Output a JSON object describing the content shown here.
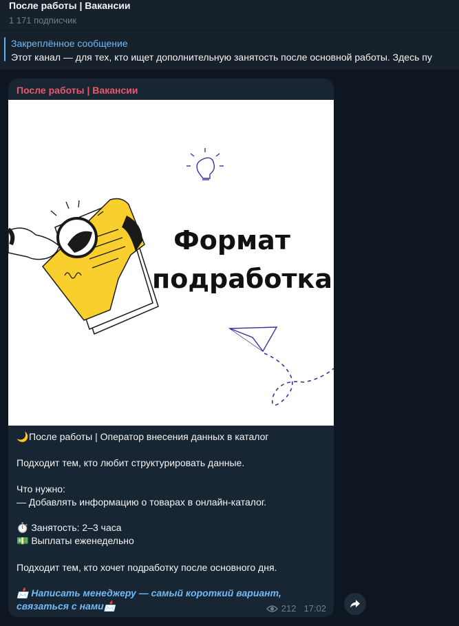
{
  "header": {
    "title": "После работы | Вакансии",
    "subscribers": "1 171 подписчик"
  },
  "pinned": {
    "title": "Закреплённое сообщение",
    "text": "Этот канал — для тех, кто ищет дополнительную занятость после основной работы.  Здесь пу"
  },
  "message": {
    "author": "После работы | Вакансии",
    "image": {
      "headline_line1": "Формат",
      "headline_line2": "подработка"
    },
    "lines": {
      "title": "После работы | Оператор внесения данных в каталог",
      "intro": "Подходит тем, кто любит структурировать данные.",
      "need_label": "Что нужно:",
      "need_item": "— Добавлять информацию о товарах в онлайн-каталог.",
      "employment": "Занятость: 2–3 часа",
      "payments": "Выплаты еженедельно",
      "closing": "Подходит тем, кто хочет подработку после основного дня.",
      "link_line1": "Написать менеджеру — самый короткий вариант,",
      "link_line2": "связаться с нами"
    },
    "views": "212",
    "time": "17:02"
  },
  "colors": {
    "background": "#0e1621",
    "panel": "#17212b",
    "bubble": "#182533",
    "author": "#e9596a",
    "link": "#71baf5",
    "muted": "#6d7f8f"
  },
  "icons": [
    "moon-emoji",
    "stopwatch-emoji",
    "banknote-emoji",
    "envelope-emoji",
    "eye-icon",
    "share-icon",
    "lightbulb-icon",
    "paper-plane-icon"
  ]
}
